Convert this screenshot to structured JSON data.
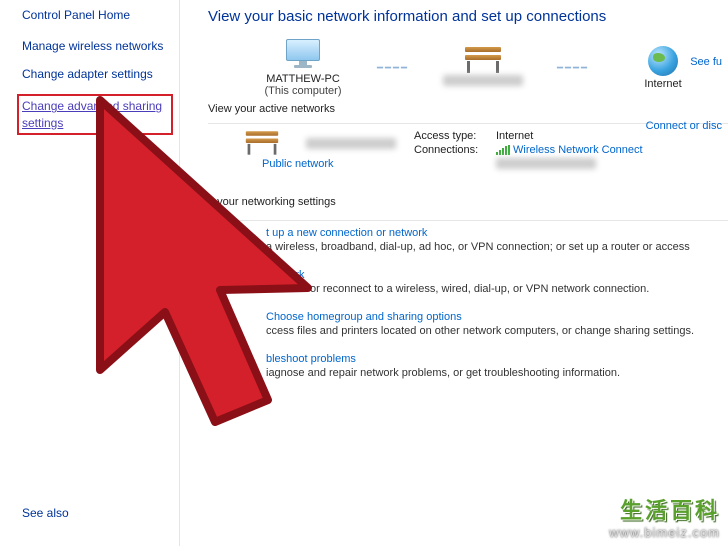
{
  "sidebar": {
    "home": "Control Panel Home",
    "links": [
      "Manage wireless networks",
      "Change adapter settings",
      "Change advanced sharing settings"
    ],
    "see_also": "See also"
  },
  "main": {
    "title": "View your basic network information and set up connections",
    "see_full": "See fu",
    "map": {
      "this_pc": "MATTHEW-PC",
      "this_pc_sub": "(This computer)",
      "internet": "Internet"
    },
    "active_label": "View your active networks",
    "connect_or": "Connect or disc",
    "public_network": "Public network",
    "conn": {
      "access_k": "Access type:",
      "access_v": "Internet",
      "connections_k": "Connections:",
      "connections_v": "Wireless Network Connect"
    },
    "tasks_hdr": "e your networking settings",
    "tasks": [
      {
        "link": "t up a new connection or network",
        "desc": "a wireless, broadband, dial-up, ad hoc, or VPN connection; or set up a router or access"
      },
      {
        "link": "network",
        "desc": "Connect or reconnect to a wireless, wired, dial-up, or VPN network connection."
      },
      {
        "link": "Choose homegroup and sharing options",
        "desc": "ccess files and printers located on other network computers, or change sharing settings."
      },
      {
        "link": "bleshoot problems",
        "desc": "iagnose and repair network problems, or get troubleshooting information."
      }
    ]
  },
  "watermark": {
    "cn": "生活百科",
    "url": "www.bimeiz.com"
  }
}
